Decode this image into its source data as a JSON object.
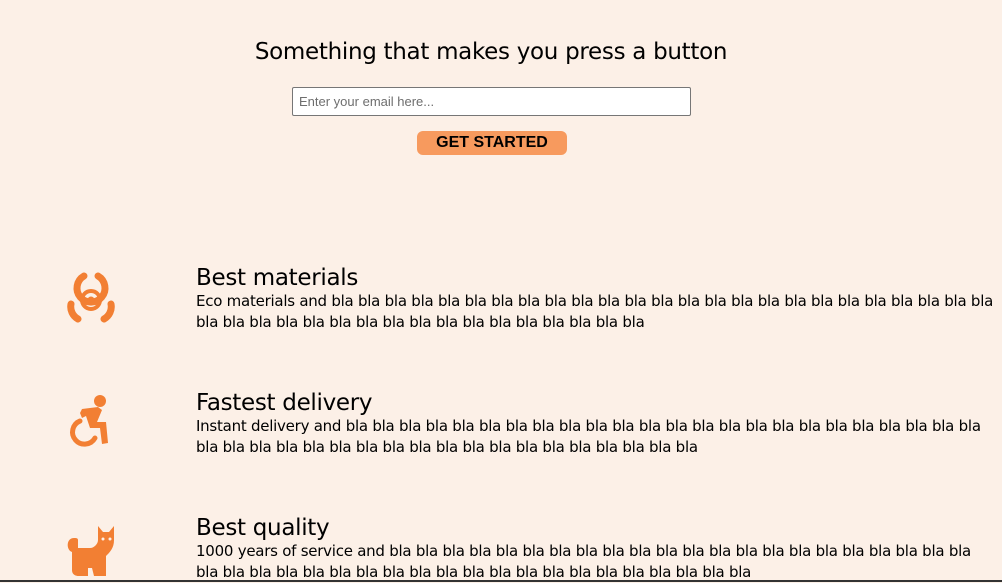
{
  "hero": {
    "title": "Something that makes you press a button",
    "email_placeholder": "Enter your email here...",
    "button_label": "GET STARTED"
  },
  "features": [
    {
      "icon": "biohazard-icon",
      "title": "Best materials",
      "text": "Eco materials and bla bla bla bla bla bla bla bla bla bla bla bla bla bla bla bla bla bla bla bla bla bla bla bla bla bla bla bla bla bla bla bla bla bla bla bla bla bla bla bla bla bla"
    },
    {
      "icon": "accessible-icon",
      "title": "Fastest delivery",
      "text": "Instant delivery and bla bla bla bla bla bla bla bla bla bla bla bla bla bla bla bla bla bla bla bla bla bla bla bla bla bla bla bla bla bla bla bla bla bla bla bla bla bla bla bla bla bla bla"
    },
    {
      "icon": "cat-icon",
      "title": "Best quality",
      "text": "1000 years of service and bla bla bla bla bla bla bla bla bla bla bla bla bla bla bla bla bla bla bla bla bla bla bla bla bla bla bla bla bla bla bla bla bla bla bla bla bla bla bla bla bla bla bla"
    }
  ],
  "colors": {
    "background": "#fcf0e7",
    "accent": "#f79a5e",
    "icon": "#f27f33"
  }
}
